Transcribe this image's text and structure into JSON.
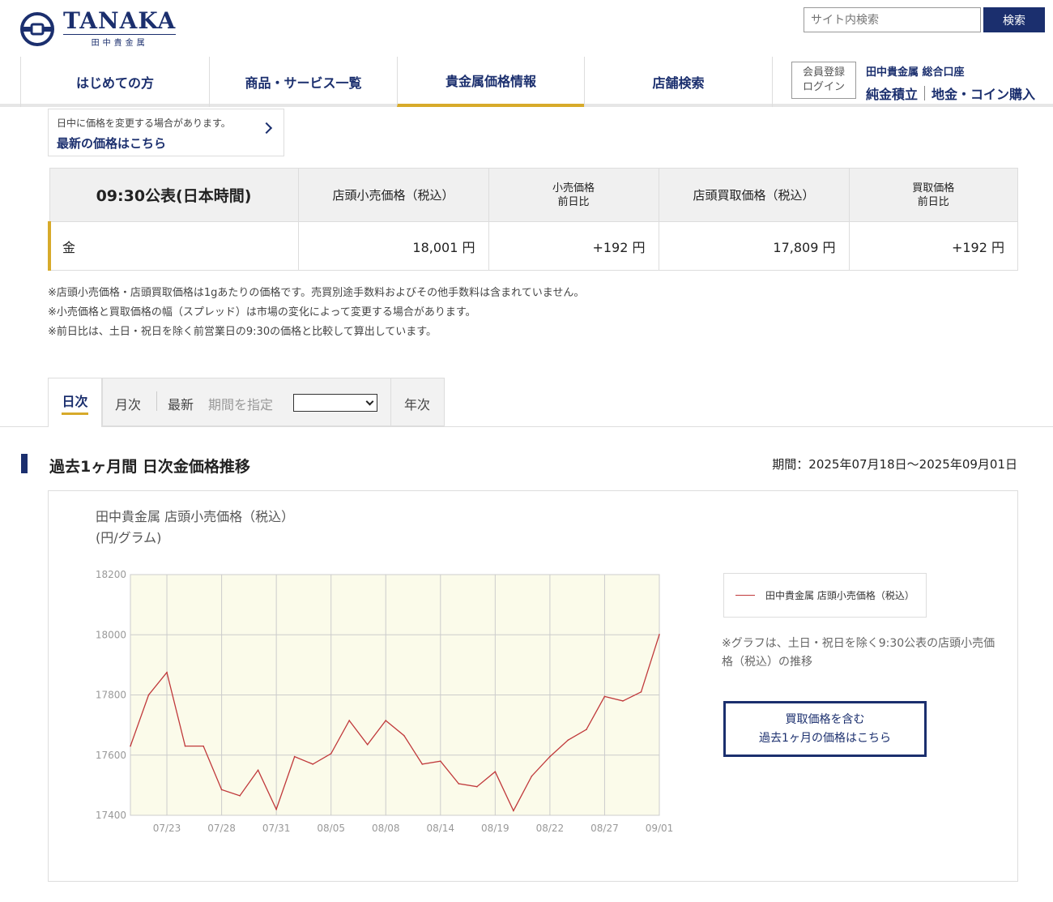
{
  "brand": {
    "name": "TANAKA",
    "subname": "田中貴金属"
  },
  "search": {
    "placeholder": "サイト内検索",
    "button": "検索"
  },
  "nav": {
    "items": [
      {
        "label": "はじめての方"
      },
      {
        "label": "商品・サービス一覧"
      },
      {
        "label": "貴金属価格情報",
        "active": true
      },
      {
        "label": "店舗検索"
      }
    ],
    "member": {
      "register": "会員登録",
      "login": "ログイン"
    },
    "account_title": "田中貴金属 総合口座",
    "links": [
      "純金積立",
      "地金・コイン購入"
    ]
  },
  "latest": {
    "note": "日中に価格を変更する場合があります。",
    "link": "最新の価格はこちら"
  },
  "price_table": {
    "headers": [
      "09:30公表(日本時間)",
      "店頭小売価格（税込）",
      "小売価格",
      "前日比",
      "店頭買取価格（税込）",
      "買取価格",
      "前日比"
    ],
    "row": {
      "metal": "金",
      "retail": "18,001 円",
      "retail_change": "+192 円",
      "buy": "17,809 円",
      "buy_change": "+192 円"
    }
  },
  "notes": [
    "※店頭小売価格・店頭買取価格は1gあたりの価格です。売買別途手数料およびその他手数料は含まれていません。",
    "※小売価格と買取価格の幅（スプレッド）は市場の変化によって変更する場合があります。",
    "※前日比は、土日・祝日を除く前営業日の9:30の価格と比較して算出しています。"
  ],
  "tabs": {
    "day": "日次",
    "month": "月次",
    "latest": "最新",
    "range": "期間を指定",
    "year": "年次"
  },
  "section": {
    "title": "過去1ヶ月間 日次金価格推移",
    "period": "期間：2025年07月18日〜2025年09月01日"
  },
  "chart_panel": {
    "title": "田中貴金属 店頭小売価格（税込）",
    "unit": "(円/グラム)",
    "note": "※グラフは、土日・祝日を除く9:30公表の店頭小売価格（税込）の推移",
    "buy_link_1": "買取価格を含む",
    "buy_link_2": "過去1ヶ月の価格はこちら"
  },
  "colors": {
    "navy": "#1b2f6e",
    "gold": "#d7aa2a",
    "series": "#c0393b",
    "plot_bg": "#fbfbea"
  },
  "chart_data": {
    "type": "line",
    "title": "田中貴金属 店頭小売価格（税込）",
    "ylabel": "(円/グラム)",
    "ylim": [
      17400,
      18200
    ],
    "yticks": [
      17400,
      17600,
      17800,
      18000,
      18200
    ],
    "xtick_labels": [
      "07/23",
      "07/28",
      "07/31",
      "08/05",
      "08/08",
      "08/14",
      "08/19",
      "08/22",
      "08/27",
      "09/01"
    ],
    "xtick_index": [
      2,
      5,
      8,
      11,
      14,
      17,
      20,
      23,
      26,
      29
    ],
    "grid": true,
    "legend_position": "right",
    "series": [
      {
        "name": "田中貴金属 店頭小売価格（税込）",
        "values": [
          17630,
          17800,
          17875,
          17630,
          17630,
          17485,
          17465,
          17550,
          17420,
          17595,
          17570,
          17605,
          17715,
          17635,
          17715,
          17665,
          17570,
          17580,
          17505,
          17495,
          17545,
          17415,
          17530,
          17595,
          17650,
          17685,
          17795,
          17780,
          17810,
          18001
        ]
      }
    ]
  }
}
